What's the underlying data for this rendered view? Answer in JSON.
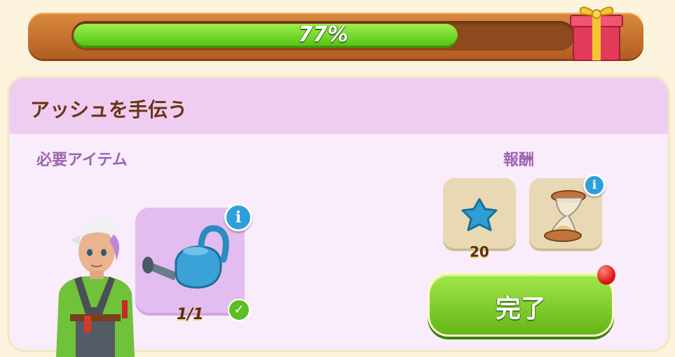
{
  "progress": {
    "percent": 77,
    "label": "77%"
  },
  "panel": {
    "title": "アッシュを手伝う",
    "required_label": "必要アイテム",
    "reward_label": "報酬"
  },
  "required_item": {
    "icon": "watering-can-icon",
    "count": "1/1",
    "completed": true
  },
  "rewards": [
    {
      "icon": "blue-star-icon",
      "amount": "20"
    },
    {
      "icon": "hourglass-icon",
      "amount": ""
    }
  ],
  "complete_button": {
    "label": "完了"
  },
  "info_glyph": "i",
  "check_glyph": "✓"
}
